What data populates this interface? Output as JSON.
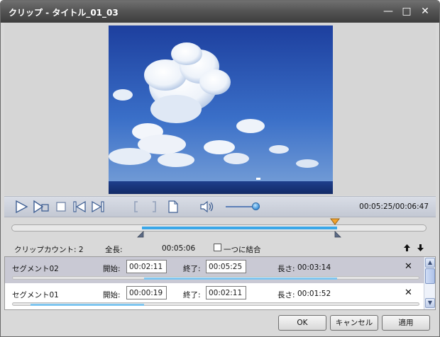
{
  "window": {
    "title": "クリップ - タイトル_01_03",
    "minimize_glyph": "—",
    "maximize_glyph": "□",
    "close_glyph": "✕"
  },
  "transport": {
    "time": "00:05:25/00:06:47",
    "volume_level": 0.88,
    "icons": [
      "play-icon",
      "play-segment-icon",
      "stop-icon",
      "previous-icon",
      "next-icon",
      "mark-in-icon",
      "mark-out-icon",
      "page-icon",
      "volume-icon"
    ]
  },
  "info": {
    "clip_count_label": "クリップカウント: 2",
    "total_label": "全長:",
    "total_value": "00:05:06",
    "merge_label": "一つに結合"
  },
  "segments": [
    {
      "name": "セグメント02",
      "start_label": "開始:",
      "start": "00:02:11",
      "end_label": "終了:",
      "end": "00:05:25",
      "length_label": "長さ:",
      "length": "00:03:14",
      "delete_glyph": "✕"
    },
    {
      "name": "セグメント01",
      "start_label": "開始:",
      "start": "00:00:19",
      "end_label": "終了:",
      "end": "00:02:11",
      "length_label": "長さ:",
      "length": "00:01:52",
      "delete_glyph": "✕"
    }
  ],
  "buttons": {
    "ok": "OK",
    "cancel": "キャンセル",
    "apply": "適用"
  },
  "colors": {
    "accent": "#3aa7e8",
    "selected_row": "#c9c9d4"
  }
}
